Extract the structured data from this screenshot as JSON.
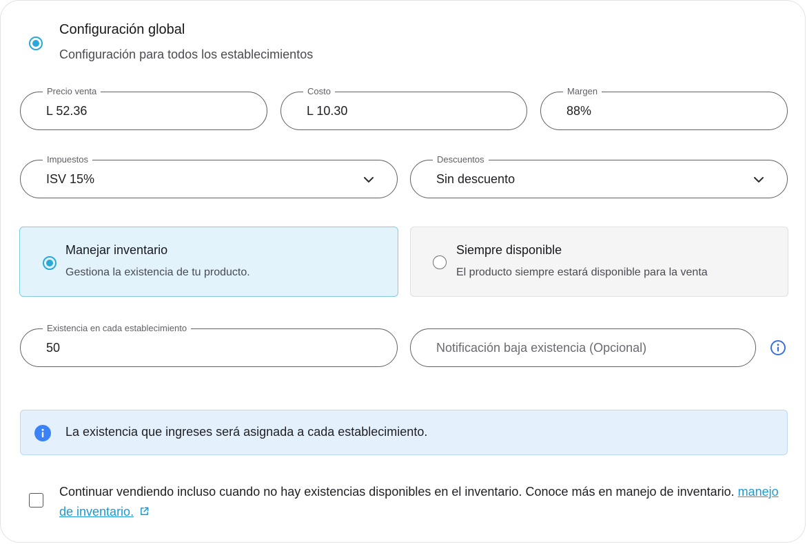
{
  "global_config": {
    "title": "Configuración global",
    "subtitle": "Configuración para todos los establecimientos"
  },
  "pricing": {
    "price": {
      "label": "Precio venta",
      "value": "L 52.36"
    },
    "cost": {
      "label": "Costo",
      "value": "L 10.30"
    },
    "margin": {
      "label": "Margen",
      "value": "88%"
    }
  },
  "taxes": {
    "label": "Impuestos",
    "selected": "ISV 15%"
  },
  "discounts": {
    "label": "Descuentos",
    "selected": "Sin descuento"
  },
  "inventory_mode": {
    "manage": {
      "title": "Manejar inventario",
      "description": "Gestiona la existencia de tu producto.",
      "selected": true
    },
    "always": {
      "title": "Siempre disponible",
      "description": "El producto siempre estará disponible para la venta",
      "selected": false
    }
  },
  "stock": {
    "label": "Existencia en cada establecimiento",
    "value": "50"
  },
  "low_stock": {
    "placeholder": "Notificación baja existencia (Opcional)"
  },
  "info_banner": {
    "text": "La existencia que ingreses será asignada a cada establecimiento."
  },
  "continue_selling": {
    "checked": false,
    "text": "Continuar vendiendo incluso cuando no hay existencias disponibles en el inventario. Conoce más en manejo de inventario.",
    "link_text": "manejo de inventario."
  },
  "colors": {
    "accent": "#2aa8d8",
    "info_blue": "#3b82f6",
    "link": "#1a9ad2"
  },
  "icons": {
    "dropdown": "chevron-down-icon",
    "info": "info-icon",
    "external_link": "external-link-icon"
  }
}
